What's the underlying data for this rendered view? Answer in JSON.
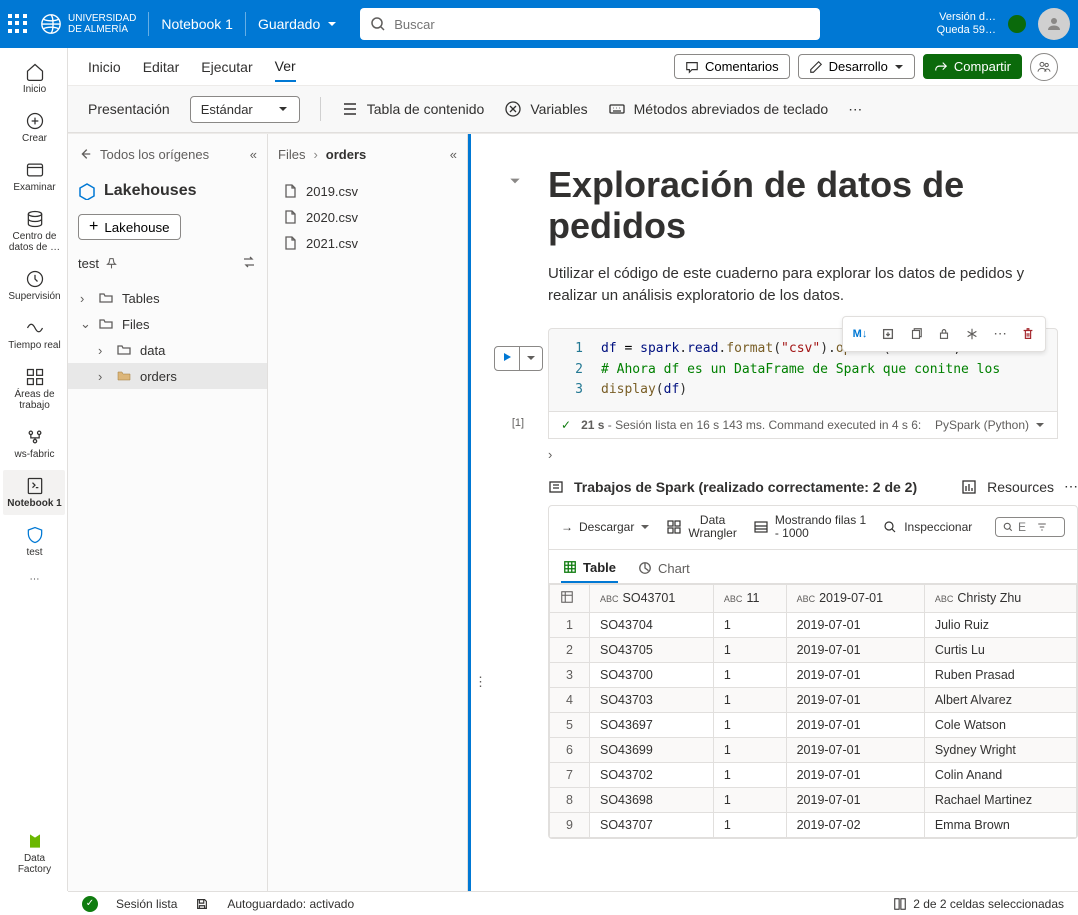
{
  "header": {
    "org_top": "UNIVERSIDAD",
    "org_bot": "DE ALMERÍA",
    "notebook": "Notebook 1",
    "saved": "Guardado",
    "search_ph": "Buscar",
    "ver_top": "Versión d…",
    "ver_bot": "Queda 59…"
  },
  "rail": {
    "home": "Inicio",
    "create": "Crear",
    "browse": "Examinar",
    "datahub1": "Centro de",
    "datahub2": "datos de …",
    "monitor": "Supervisión",
    "realtime": "Tiempo real",
    "work1": "Áreas de",
    "work2": "trabajo",
    "ws": "ws-fabric",
    "nb": "Notebook 1",
    "test": "test",
    "bottom": "Data Factory"
  },
  "ribbon": {
    "tabs": [
      "Inicio",
      "Editar",
      "Ejecutar",
      "Ver"
    ],
    "comments": "Comentarios",
    "dev": "Desarrollo",
    "share": "Compartir"
  },
  "toolbar2": {
    "pres": "Presentación",
    "std": "Estándar",
    "toc": "Tabla de contenido",
    "vars": "Variables",
    "keys": "Métodos abreviados de teclado"
  },
  "panel1": {
    "back": "Todos los orígenes",
    "title": "Lakehouses",
    "add": "Lakehouse",
    "testname": "test",
    "tables": "Tables",
    "files": "Files",
    "data": "data",
    "orders": "orders"
  },
  "panel2": {
    "root": "Files",
    "cur": "orders",
    "files": [
      "2019.csv",
      "2020.csv",
      "2021.csv"
    ]
  },
  "doc": {
    "title": "Exploración de datos de pedidos",
    "desc": "Utilizar el código de este cuaderno para explorar los datos de pedidos y realizar un análisis exploratorio de los datos.",
    "exec": "[1]",
    "status_time": "21 s",
    "status_msg": "- Sesión lista en 16 s 143 ms. Command executed in 4 s 6:",
    "lang": "PySpark (Python)",
    "jobs": "Trabajos de Spark (realizado correctamente: 2 de 2)",
    "resources": "Resources",
    "download": "Descargar",
    "wrangler1": "Data",
    "wrangler2": "Wrangler",
    "rows1": "Mostrando filas 1",
    "rows2": "- 1000",
    "inspect": "Inspeccionar",
    "search_ph": "E",
    "tab_table": "Table",
    "tab_chart": "Chart",
    "headers": [
      "SO43701",
      "11",
      "2019-07-01",
      "Christy Zhu"
    ]
  },
  "table_rows": [
    {
      "i": "1",
      "a": "SO43704",
      "b": "1",
      "c": "2019-07-01",
      "d": "Julio Ruiz"
    },
    {
      "i": "2",
      "a": "SO43705",
      "b": "1",
      "c": "2019-07-01",
      "d": "Curtis Lu"
    },
    {
      "i": "3",
      "a": "SO43700",
      "b": "1",
      "c": "2019-07-01",
      "d": "Ruben Prasad"
    },
    {
      "i": "4",
      "a": "SO43703",
      "b": "1",
      "c": "2019-07-01",
      "d": "Albert Alvarez"
    },
    {
      "i": "5",
      "a": "SO43697",
      "b": "1",
      "c": "2019-07-01",
      "d": "Cole Watson"
    },
    {
      "i": "6",
      "a": "SO43699",
      "b": "1",
      "c": "2019-07-01",
      "d": "Sydney Wright"
    },
    {
      "i": "7",
      "a": "SO43702",
      "b": "1",
      "c": "2019-07-01",
      "d": "Colin Anand"
    },
    {
      "i": "8",
      "a": "SO43698",
      "b": "1",
      "c": "2019-07-01",
      "d": "Rachael Martinez"
    },
    {
      "i": "9",
      "a": "SO43707",
      "b": "1",
      "c": "2019-07-02",
      "d": "Emma Brown"
    }
  ],
  "footer": {
    "session": "Sesión lista",
    "autosave": "Autoguardado: activado",
    "selection": "2 de 2 celdas seleccionadas"
  }
}
